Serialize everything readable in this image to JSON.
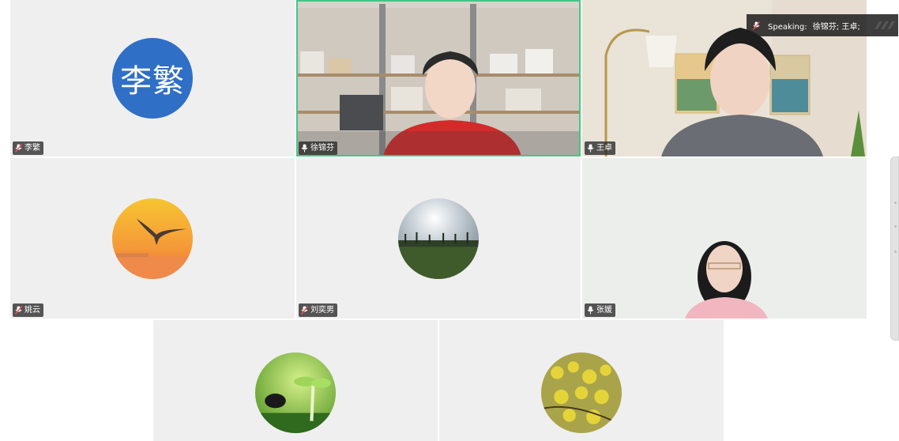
{
  "speaking": {
    "label": "Speaking:",
    "names": "徐锦芬; 王卓;"
  },
  "participants": [
    {
      "name": "李繁",
      "avatar_text": "李繁",
      "avatar_type": "initials",
      "avatar_color": "#2f6fc6",
      "mic": "muted",
      "video": false
    },
    {
      "name": "徐锦芬",
      "mic": "on",
      "video": true,
      "active_speaker": true
    },
    {
      "name": "王卓",
      "mic": "on",
      "video": true
    },
    {
      "name": "姚云",
      "avatar_type": "image",
      "avatar_image": "sunset-bird",
      "mic": "muted",
      "video": false
    },
    {
      "name": "刘奕男",
      "avatar_type": "image",
      "avatar_image": "palm-trees-sky",
      "mic": "muted",
      "video": false
    },
    {
      "name": "张媛",
      "mic": "on",
      "video": true
    },
    {
      "name": "",
      "avatar_type": "image",
      "avatar_image": "seedlings",
      "video": false
    },
    {
      "name": "",
      "avatar_type": "image",
      "avatar_image": "yellow-flowers",
      "video": false
    }
  ],
  "colors": {
    "tile_bg": "#efefef",
    "active_border": "#45c486",
    "initials_avatar": "#2f6fc6"
  },
  "icons": {
    "muted_mic": "mic-off-icon",
    "mic": "mic-icon"
  }
}
